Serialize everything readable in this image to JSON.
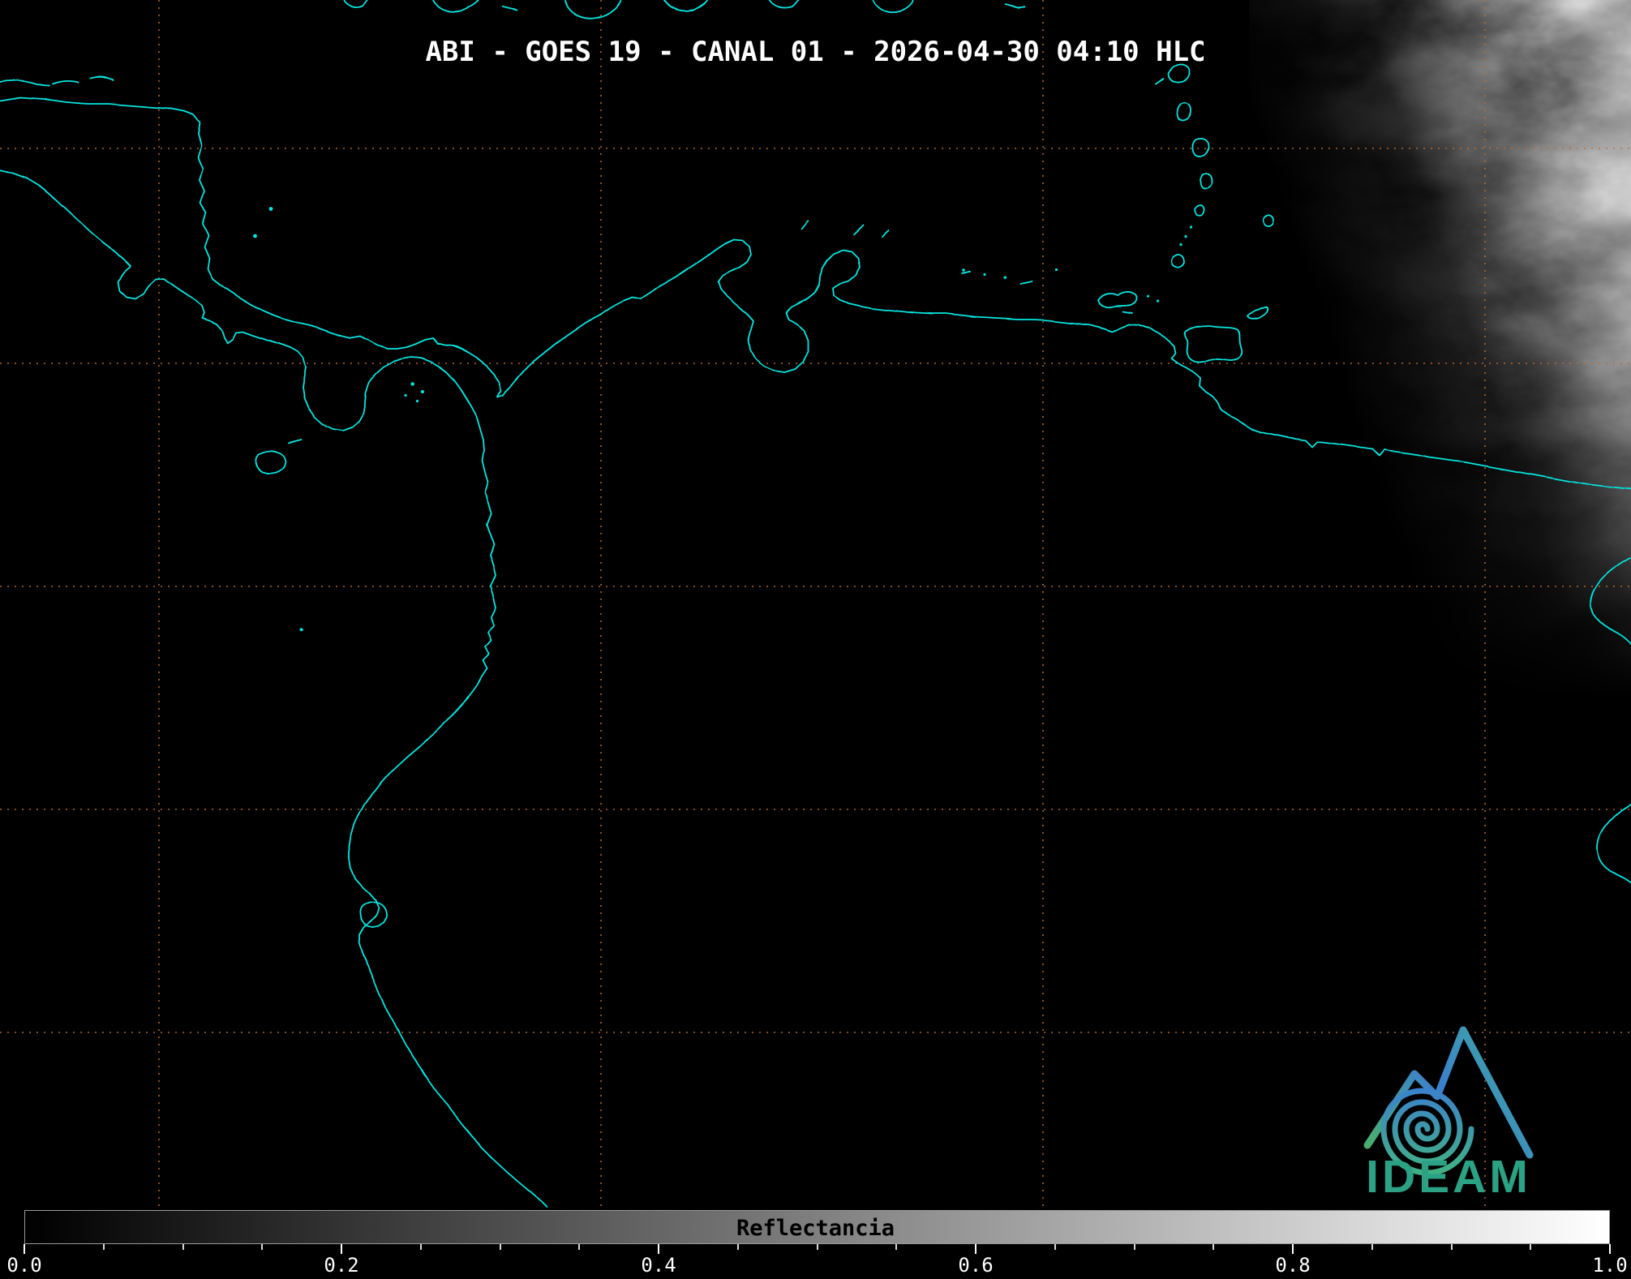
{
  "header": {
    "title": "ABI - GOES 19 - CANAL 01 - 2026-04-30 04:10 HLC"
  },
  "colorbar": {
    "label": "Reflectancia",
    "ticks": [
      "0.0",
      "0.2",
      "0.4",
      "0.6",
      "0.8",
      "1.0"
    ],
    "tick_values": [
      0,
      0.2,
      0.4,
      0.6,
      0.8,
      1.0
    ],
    "minor_tick_step": 0.05,
    "gradient_start": "#000000",
    "gradient_end": "#ffffff"
  },
  "branding": {
    "logo_text": "IDEAM",
    "logo_color": "#2ba284"
  },
  "map": {
    "coastline_color": "#00e6e0",
    "grid_color": "#c06a2c",
    "background": "#000000"
  }
}
